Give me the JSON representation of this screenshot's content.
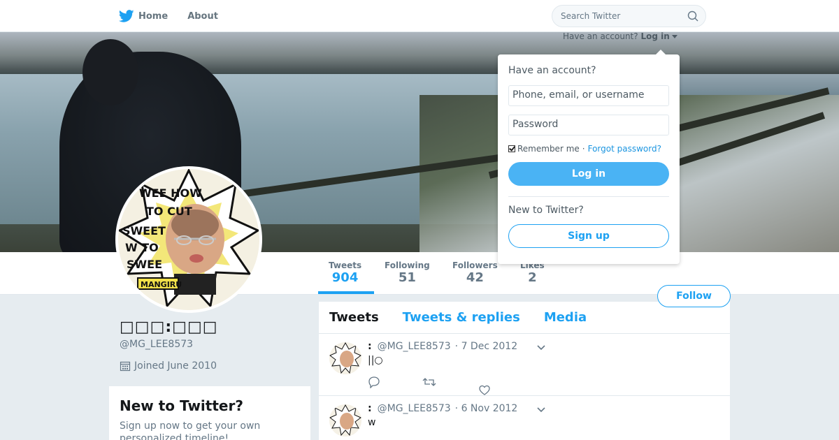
{
  "nav": {
    "home_label": "Home",
    "about_label": "About",
    "search_placeholder": "Search Twitter"
  },
  "login_hint": {
    "prompt": "Have an account?",
    "action": "Log in"
  },
  "login_dropdown": {
    "title": "Have an account?",
    "username_placeholder": "Phone, email, or username",
    "password_placeholder": "Password",
    "remember_label": "Remember me",
    "separator": "·",
    "forgot_label": "Forgot password?",
    "login_button": "Log in",
    "new_label": "New to Twitter?",
    "signup_button": "Sign up"
  },
  "profile": {
    "display_name": "□□□:□□□",
    "handle": "@MG_LEE8573",
    "joined": "Joined June 2010",
    "follow_label": "Follow",
    "avatar_badge": "MANGIRU"
  },
  "stats": [
    {
      "label": "Tweets",
      "value": "904"
    },
    {
      "label": "Following",
      "value": "51"
    },
    {
      "label": "Followers",
      "value": "42"
    },
    {
      "label": "Likes",
      "value": "2"
    }
  ],
  "newbox": {
    "title": "New to Twitter?",
    "text": "Sign up now to get your own personalized timeline!"
  },
  "timeline": {
    "tabs": [
      "Tweets",
      "Tweets & replies",
      "Media"
    ],
    "tweets": [
      {
        "name": ":",
        "handle": "@MG_LEE8573",
        "date": "· 7 Dec 2012",
        "text": "||○"
      },
      {
        "name": ":",
        "handle": "@MG_LEE8573",
        "date": "· 6 Nov 2012",
        "text": "w"
      }
    ]
  },
  "colors": {
    "accent": "#1da1f2",
    "login_button": "#4ab3f4",
    "background": "#e6ecf0"
  }
}
